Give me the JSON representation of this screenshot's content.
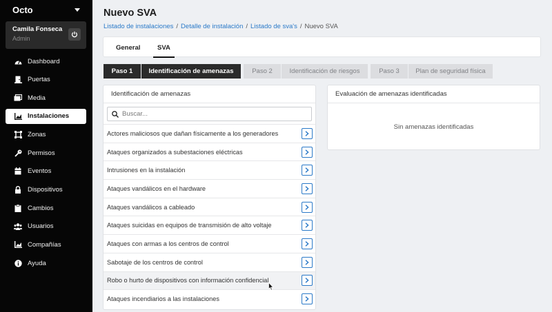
{
  "app": {
    "name": "Octo"
  },
  "user": {
    "name": "Camila Fonseca",
    "role": "Admin"
  },
  "nav": [
    {
      "label": "Dashboard",
      "icon": "dashboard-icon",
      "active": false
    },
    {
      "label": "Puertas",
      "icon": "door-icon",
      "active": false
    },
    {
      "label": "Media",
      "icon": "media-icon",
      "active": false
    },
    {
      "label": "Instalaciones",
      "icon": "chart-icon",
      "active": true
    },
    {
      "label": "Zonas",
      "icon": "zone-icon",
      "active": false
    },
    {
      "label": "Permisos",
      "icon": "key-icon",
      "active": false
    },
    {
      "label": "Eventos",
      "icon": "calendar-icon",
      "active": false
    },
    {
      "label": "Dispositivos",
      "icon": "lock-icon",
      "active": false
    },
    {
      "label": "Cambios",
      "icon": "clipboard-icon",
      "active": false
    },
    {
      "label": "Usuarios",
      "icon": "users-icon",
      "active": false
    },
    {
      "label": "Compañías",
      "icon": "company-chart-icon",
      "active": false
    },
    {
      "label": "Ayuda",
      "icon": "info-icon",
      "active": false
    }
  ],
  "page": {
    "title": "Nuevo SVA",
    "breadcrumb": [
      {
        "label": "Listado de instalaciones",
        "link": true
      },
      {
        "label": "Detalle de instalación",
        "link": true
      },
      {
        "label": "Listado de sva's",
        "link": true
      },
      {
        "label": "Nuevo SVA",
        "link": false
      }
    ]
  },
  "tabs": [
    {
      "label": "General",
      "active": false
    },
    {
      "label": "SVA",
      "active": true
    }
  ],
  "steps": [
    {
      "number": "Paso 1",
      "label": "Identificación de amenazas",
      "active": true
    },
    {
      "number": "Paso 2",
      "label": "Identificación de riesgos",
      "active": false
    },
    {
      "number": "Paso 3",
      "label": "Plan de seguridad física",
      "active": false
    }
  ],
  "threats_panel": {
    "title": "Identificación de amenazas",
    "search_placeholder": "Buscar...",
    "items": [
      "Actores maliciosos que dañan físicamente a los generadores",
      "Ataques organizados a subestaciones eléctricas",
      "Intrusiones en la instalación",
      "Ataques vandálicos en el hardware",
      "Ataques vandálicos a cableado",
      "Ataques suicidas en equipos de transmisión de alto voltaje",
      "Ataques con armas a los centros de control",
      "Sabotaje de los centros de control",
      "Robo o hurto de dispositivos con información confidencial",
      "Ataques incendiarios a las instalaciones"
    ]
  },
  "evaluation_panel": {
    "title": "Evaluación de amenazas identificadas",
    "empty_message": "Sin amenazas identificadas"
  },
  "colors": {
    "link": "#2a79c8",
    "sidebar": "#060606",
    "step_active": "#2b2b2b"
  }
}
